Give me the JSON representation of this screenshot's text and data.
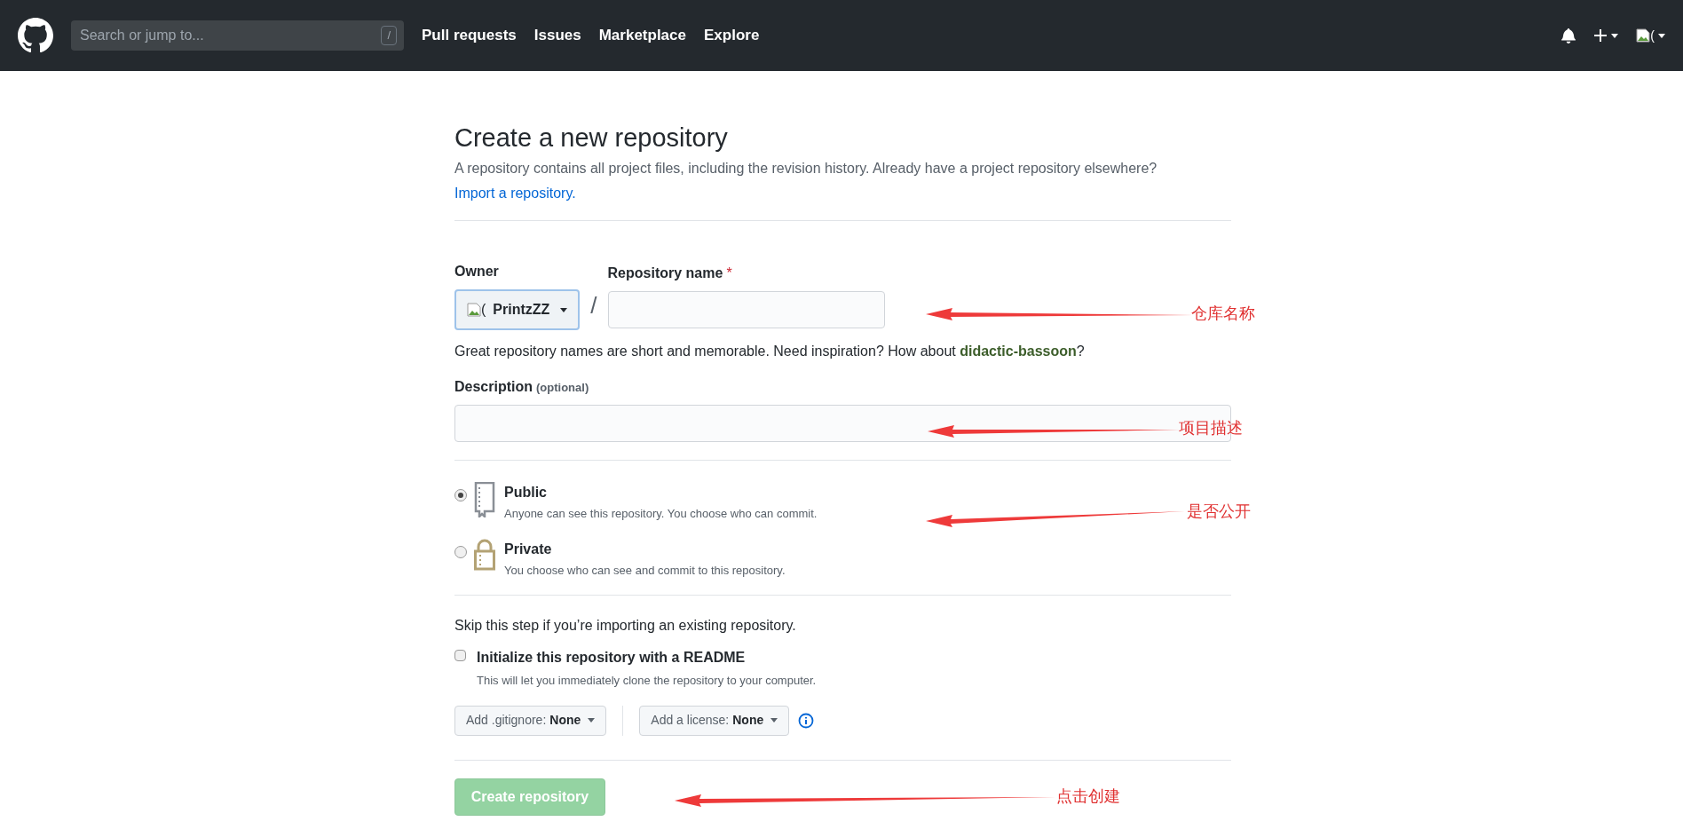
{
  "header": {
    "search": {
      "placeholder": "Search or jump to...",
      "shortcut": "/"
    },
    "nav": [
      "Pull requests",
      "Issues",
      "Marketplace",
      "Explore"
    ],
    "avatar_alt": "("
  },
  "page": {
    "title": "Create a new repository",
    "subtitle": "A repository contains all project files, including the revision history. Already have a project repository elsewhere?",
    "import_link": "Import a repository."
  },
  "owner": {
    "label": "Owner",
    "avatar_alt": "(",
    "value": "PrintzZZ"
  },
  "separator": "/",
  "repo_name": {
    "label": "Repository name",
    "required": "*"
  },
  "name_hint": {
    "text": "Great repository names are short and memorable. Need inspiration? How about",
    "suggestion": "didactic-bassoon",
    "end": "?"
  },
  "description": {
    "label": "Description",
    "optional": "(optional)"
  },
  "visibility": [
    {
      "kind": "public",
      "title": "Public",
      "text": "Anyone can see this repository. You choose who can commit.",
      "selected": true
    },
    {
      "kind": "private",
      "title": "Private",
      "text": "You choose who can see and commit to this repository.",
      "selected": false
    }
  ],
  "skip_note": "Skip this step if you’re importing an existing repository.",
  "readme": {
    "label": "Initialize this repository with a README",
    "text": "This will let you immediately clone the repository to your computer.",
    "checked": false
  },
  "dropdowns": [
    {
      "label": "Add .gitignore:",
      "value": "None"
    },
    {
      "label": "Add a license:",
      "value": "None"
    }
  ],
  "create_button": {
    "label": "Create repository",
    "disabled": true
  },
  "annotations": [
    "仓库名称",
    "项目描述",
    "是否公开",
    "点击创建"
  ]
}
